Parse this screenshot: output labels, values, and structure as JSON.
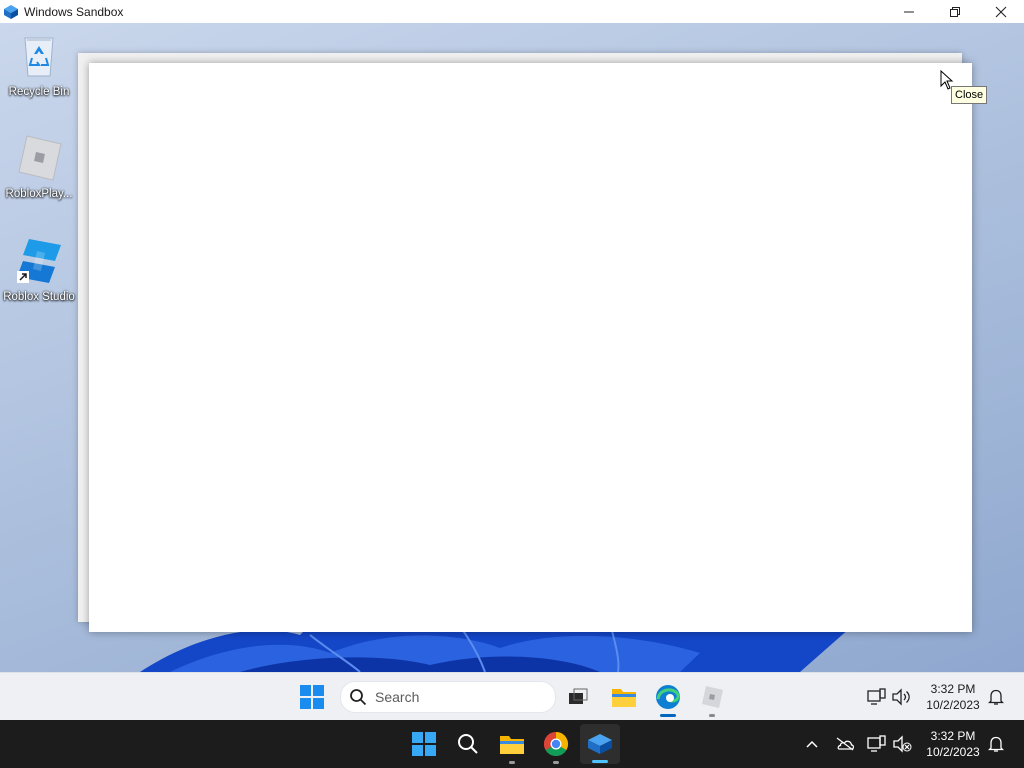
{
  "host_window": {
    "title": "Windows Sandbox",
    "controls": [
      "minimize-icon",
      "restore-icon",
      "close-icon"
    ]
  },
  "desktop": {
    "icons": [
      {
        "label": "Recycle Bin",
        "icon": "recycle-bin-icon"
      },
      {
        "label": "RobloxPlay...",
        "icon": "roblox-player-icon"
      },
      {
        "label": "Roblox Studio",
        "icon": "roblox-studio-icon"
      }
    ]
  },
  "tooltip": {
    "text": "Close"
  },
  "inner_taskbar": {
    "search_placeholder": "Search",
    "apps": [
      "start-icon",
      "search-icon",
      "task-view-icon",
      "file-explorer-icon",
      "edge-icon",
      "roblox-player-icon"
    ],
    "clock": {
      "time": "3:32 PM",
      "date": "10/2/2023"
    },
    "tray": [
      "network-icon",
      "volume-icon",
      "notification-icon"
    ]
  },
  "host_taskbar": {
    "apps": [
      "start-icon",
      "search-icon",
      "file-explorer-icon",
      "chrome-icon",
      "windows-sandbox-icon"
    ],
    "clock": {
      "time": "3:32 PM",
      "date": "10/2/2023"
    },
    "tray": [
      "chevron-up-icon",
      "onedrive-icon",
      "network-icon",
      "volume-muted-icon",
      "notification-icon"
    ]
  },
  "colors": {
    "accent": "#0067c0",
    "desktop_light": "#aec1de",
    "bloom": "#1446c8",
    "host_taskbar": "#1c1c1c",
    "inner_taskbar": "#eef0f4",
    "tooltip_bg": "#ffffe1"
  }
}
